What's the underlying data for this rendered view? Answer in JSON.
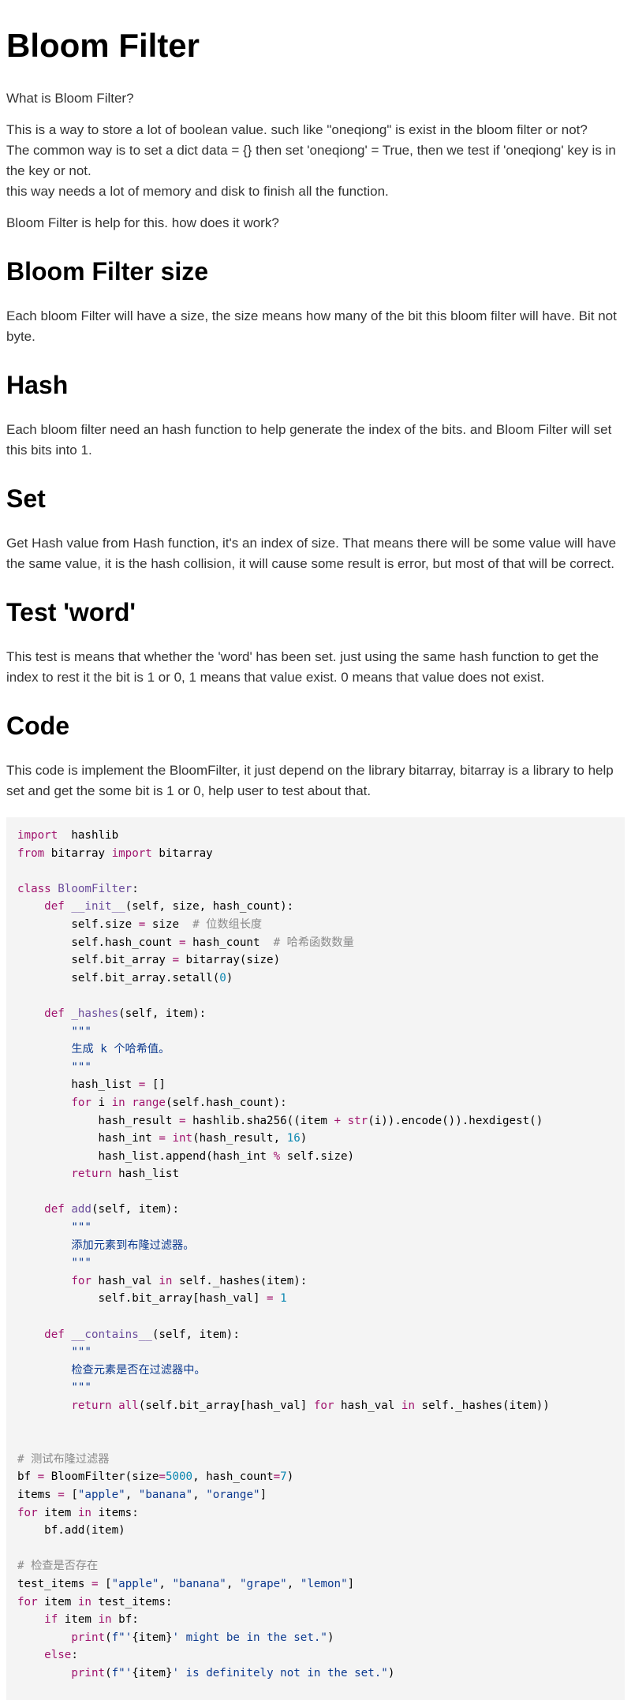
{
  "title": "Bloom Filter",
  "intro": {
    "question": "What is Bloom Filter?",
    "lines": [
      "This is a way to store a lot of boolean value. such like \"oneqiong\" is exist in the bloom filter or not?",
      "The common way is to set a dict data = {} then set 'oneqiong' = True, then we test if 'oneqiong' key is in the key or not.",
      "this way needs a lot of memory and disk to finish all the function."
    ],
    "help": "Bloom Filter is help for this. how does it work?"
  },
  "sections": [
    {
      "heading": "Bloom Filter size",
      "body": "Each bloom Filter will have a size, the size means how many of the bit this bloom filter will have. Bit not byte."
    },
    {
      "heading": "Hash",
      "body": "Each bloom filter need an hash function to help generate the index of the bits. and Bloom Filter will set this bits into 1."
    },
    {
      "heading": "Set",
      "body": "Get Hash value from Hash function, it's an index of size. That means there will be some value will have the same value, it is the hash collision, it will cause some result is error, but most of that will be correct."
    },
    {
      "heading": "Test 'word'",
      "body": "This test is means that whether the 'word' has been set. just using the same hash function to get the index to rest it the bit is 1 or 0, 1 means that value exist. 0 means that value does not exist."
    },
    {
      "heading": "Code",
      "body": "This code is implement the BloomFilter, it just depend on the library bitarray, bitarray is a library to help set and get the some bit is 1 or 0, help user to test about that."
    }
  ],
  "code_lines": [
    [
      [
        "kw",
        "import"
      ],
      [
        "",
        "  hashlib"
      ]
    ],
    [
      [
        "kw",
        "from"
      ],
      [
        "",
        " bitarray "
      ],
      [
        "kw",
        "import"
      ],
      [
        "",
        " bitarray"
      ]
    ],
    [],
    [
      [
        "kw",
        "class"
      ],
      [
        "",
        " "
      ],
      [
        "fn",
        "BloomFilter"
      ],
      [
        "",
        ":"
      ]
    ],
    [
      [
        "",
        "    "
      ],
      [
        "kw",
        "def"
      ],
      [
        "",
        " "
      ],
      [
        "fn",
        "__init__"
      ],
      [
        "",
        "(self, size, hash_count):"
      ]
    ],
    [
      [
        "",
        "        self.size "
      ],
      [
        "op",
        "="
      ],
      [
        "",
        " size  "
      ],
      [
        "cm",
        "# 位数组长度"
      ]
    ],
    [
      [
        "",
        "        self.hash_count "
      ],
      [
        "op",
        "="
      ],
      [
        "",
        " hash_count  "
      ],
      [
        "cm",
        "# 哈希函数数量"
      ]
    ],
    [
      [
        "",
        "        self.bit_array "
      ],
      [
        "op",
        "="
      ],
      [
        "",
        " bitarray(size)"
      ]
    ],
    [
      [
        "",
        "        self.bit_array.setall("
      ],
      [
        "nm",
        "0"
      ],
      [
        "",
        ")"
      ]
    ],
    [],
    [
      [
        "",
        "    "
      ],
      [
        "kw",
        "def"
      ],
      [
        "",
        " "
      ],
      [
        "fn",
        "_hashes"
      ],
      [
        "",
        "(self, item):"
      ]
    ],
    [
      [
        "",
        "        "
      ],
      [
        "st",
        "\"\"\""
      ]
    ],
    [
      [
        "",
        "        "
      ],
      [
        "st",
        "生成 k 个哈希值。"
      ]
    ],
    [
      [
        "",
        "        "
      ],
      [
        "st",
        "\"\"\""
      ]
    ],
    [
      [
        "",
        "        hash_list "
      ],
      [
        "op",
        "="
      ],
      [
        "",
        " []"
      ]
    ],
    [
      [
        "",
        "        "
      ],
      [
        "kw",
        "for"
      ],
      [
        "",
        " i "
      ],
      [
        "kw",
        "in"
      ],
      [
        "",
        " "
      ],
      [
        "kw",
        "range"
      ],
      [
        "",
        "(self.hash_count):"
      ]
    ],
    [
      [
        "",
        "            hash_result "
      ],
      [
        "op",
        "="
      ],
      [
        "",
        " hashlib.sha256((item "
      ],
      [
        "op",
        "+"
      ],
      [
        "",
        " "
      ],
      [
        "kw",
        "str"
      ],
      [
        "",
        "(i)).encode()).hexdigest()"
      ]
    ],
    [
      [
        "",
        "            hash_int "
      ],
      [
        "op",
        "="
      ],
      [
        "",
        " "
      ],
      [
        "kw",
        "int"
      ],
      [
        "",
        "(hash_result, "
      ],
      [
        "nm",
        "16"
      ],
      [
        "",
        ")"
      ]
    ],
    [
      [
        "",
        "            hash_list.append(hash_int "
      ],
      [
        "op",
        "%"
      ],
      [
        "",
        " self.size)"
      ]
    ],
    [
      [
        "",
        "        "
      ],
      [
        "kw",
        "return"
      ],
      [
        "",
        " hash_list"
      ]
    ],
    [],
    [
      [
        "",
        "    "
      ],
      [
        "kw",
        "def"
      ],
      [
        "",
        " "
      ],
      [
        "fn",
        "add"
      ],
      [
        "",
        "(self, item):"
      ]
    ],
    [
      [
        "",
        "        "
      ],
      [
        "st",
        "\"\"\""
      ]
    ],
    [
      [
        "",
        "        "
      ],
      [
        "st",
        "添加元素到布隆过滤器。"
      ]
    ],
    [
      [
        "",
        "        "
      ],
      [
        "st",
        "\"\"\""
      ]
    ],
    [
      [
        "",
        "        "
      ],
      [
        "kw",
        "for"
      ],
      [
        "",
        " hash_val "
      ],
      [
        "kw",
        "in"
      ],
      [
        "",
        " self._hashes(item):"
      ]
    ],
    [
      [
        "",
        "            self.bit_array[hash_val] "
      ],
      [
        "op",
        "="
      ],
      [
        "",
        " "
      ],
      [
        "nm",
        "1"
      ]
    ],
    [],
    [
      [
        "",
        "    "
      ],
      [
        "kw",
        "def"
      ],
      [
        "",
        " "
      ],
      [
        "fn",
        "__contains__"
      ],
      [
        "",
        "(self, item):"
      ]
    ],
    [
      [
        "",
        "        "
      ],
      [
        "st",
        "\"\"\""
      ]
    ],
    [
      [
        "",
        "        "
      ],
      [
        "st",
        "检查元素是否在过滤器中。"
      ]
    ],
    [
      [
        "",
        "        "
      ],
      [
        "st",
        "\"\"\""
      ]
    ],
    [
      [
        "",
        "        "
      ],
      [
        "kw",
        "return"
      ],
      [
        "",
        " "
      ],
      [
        "kw",
        "all"
      ],
      [
        "",
        "(self.bit_array[hash_val] "
      ],
      [
        "kw",
        "for"
      ],
      [
        "",
        " hash_val "
      ],
      [
        "kw",
        "in"
      ],
      [
        "",
        " self._hashes(item))"
      ]
    ],
    [],
    [],
    [
      [
        "cm",
        "# 测试布隆过滤器"
      ]
    ],
    [
      [
        "",
        "bf "
      ],
      [
        "op",
        "="
      ],
      [
        "",
        " BloomFilter(size"
      ],
      [
        "op",
        "="
      ],
      [
        "nm",
        "5000"
      ],
      [
        "",
        ", hash_count"
      ],
      [
        "op",
        "="
      ],
      [
        "nm",
        "7"
      ],
      [
        "",
        ")"
      ]
    ],
    [
      [
        "",
        "items "
      ],
      [
        "op",
        "="
      ],
      [
        "",
        " ["
      ],
      [
        "st",
        "\"apple\""
      ],
      [
        "",
        ", "
      ],
      [
        "st",
        "\"banana\""
      ],
      [
        "",
        ", "
      ],
      [
        "st",
        "\"orange\""
      ],
      [
        "",
        "]"
      ]
    ],
    [
      [
        "kw",
        "for"
      ],
      [
        "",
        " item "
      ],
      [
        "kw",
        "in"
      ],
      [
        "",
        " items:"
      ]
    ],
    [
      [
        "",
        "    bf.add(item)"
      ]
    ],
    [],
    [
      [
        "cm",
        "# 检查是否存在"
      ]
    ],
    [
      [
        "",
        "test_items "
      ],
      [
        "op",
        "="
      ],
      [
        "",
        " ["
      ],
      [
        "st",
        "\"apple\""
      ],
      [
        "",
        ", "
      ],
      [
        "st",
        "\"banana\""
      ],
      [
        "",
        ", "
      ],
      [
        "st",
        "\"grape\""
      ],
      [
        "",
        ", "
      ],
      [
        "st",
        "\"lemon\""
      ],
      [
        "",
        "]"
      ]
    ],
    [
      [
        "kw",
        "for"
      ],
      [
        "",
        " item "
      ],
      [
        "kw",
        "in"
      ],
      [
        "",
        " test_items:"
      ]
    ],
    [
      [
        "",
        "    "
      ],
      [
        "kw",
        "if"
      ],
      [
        "",
        " item "
      ],
      [
        "kw",
        "in"
      ],
      [
        "",
        " bf:"
      ]
    ],
    [
      [
        "",
        "        "
      ],
      [
        "kw",
        "print"
      ],
      [
        "",
        "("
      ],
      [
        "st",
        "f\"'"
      ],
      [
        "",
        "{item}"
      ],
      [
        "st",
        "' might be in the set.\""
      ],
      [
        "",
        ")"
      ]
    ],
    [
      [
        "",
        "    "
      ],
      [
        "kw",
        "else"
      ],
      [
        "",
        ":"
      ]
    ],
    [
      [
        "",
        "        "
      ],
      [
        "kw",
        "print"
      ],
      [
        "",
        "("
      ],
      [
        "st",
        "f\"'"
      ],
      [
        "",
        "{item}"
      ],
      [
        "st",
        "' is definitely not in the set.\""
      ],
      [
        "",
        ")"
      ]
    ]
  ]
}
